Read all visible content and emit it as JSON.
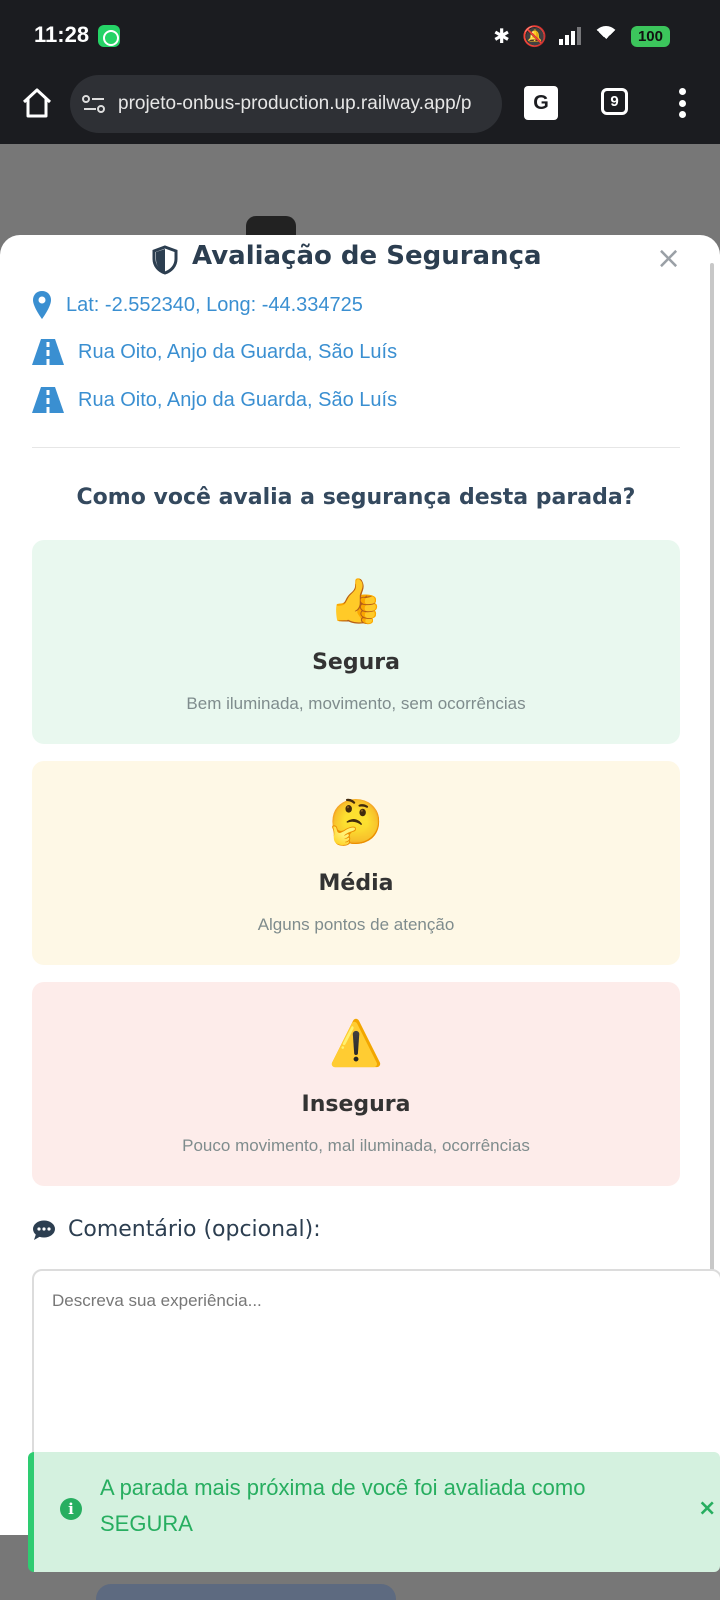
{
  "status_bar": {
    "time": "11:28",
    "battery": "100"
  },
  "browser": {
    "url": "projeto-onbus-production.up.railway.app/p",
    "tab_count": "9"
  },
  "modal": {
    "title": "Avaliação de Segurança",
    "close_label": "×",
    "coords": "Lat: -2.552340, Long: -44.334725",
    "address_1": "Rua Oito, Anjo da Guarda, São Luís",
    "address_2": "Rua Oito, Anjo da Guarda, São Luís",
    "question": "Como você avalia a segurança desta parada?",
    "options": [
      {
        "emoji": "👍",
        "title": "Segura",
        "description": "Bem iluminada, movimento, sem ocorrências",
        "color": "#e9f8ef"
      },
      {
        "emoji": "🤔",
        "title": "Média",
        "description": "Alguns pontos de atenção",
        "color": "#fef8e6"
      },
      {
        "emoji": "⚠️",
        "title": "Insegura",
        "description": "Pouco movimento, mal iluminada, ocorrências",
        "color": "#fdecea"
      }
    ],
    "comment_label": "Comentário (opcional):",
    "comment_placeholder": "Descreva sua experiência..."
  },
  "toast": {
    "message": "A parada mais próxima de você foi avaliada como SEGURA",
    "icon": "i",
    "close_label": "×",
    "color": "#27ae60"
  }
}
